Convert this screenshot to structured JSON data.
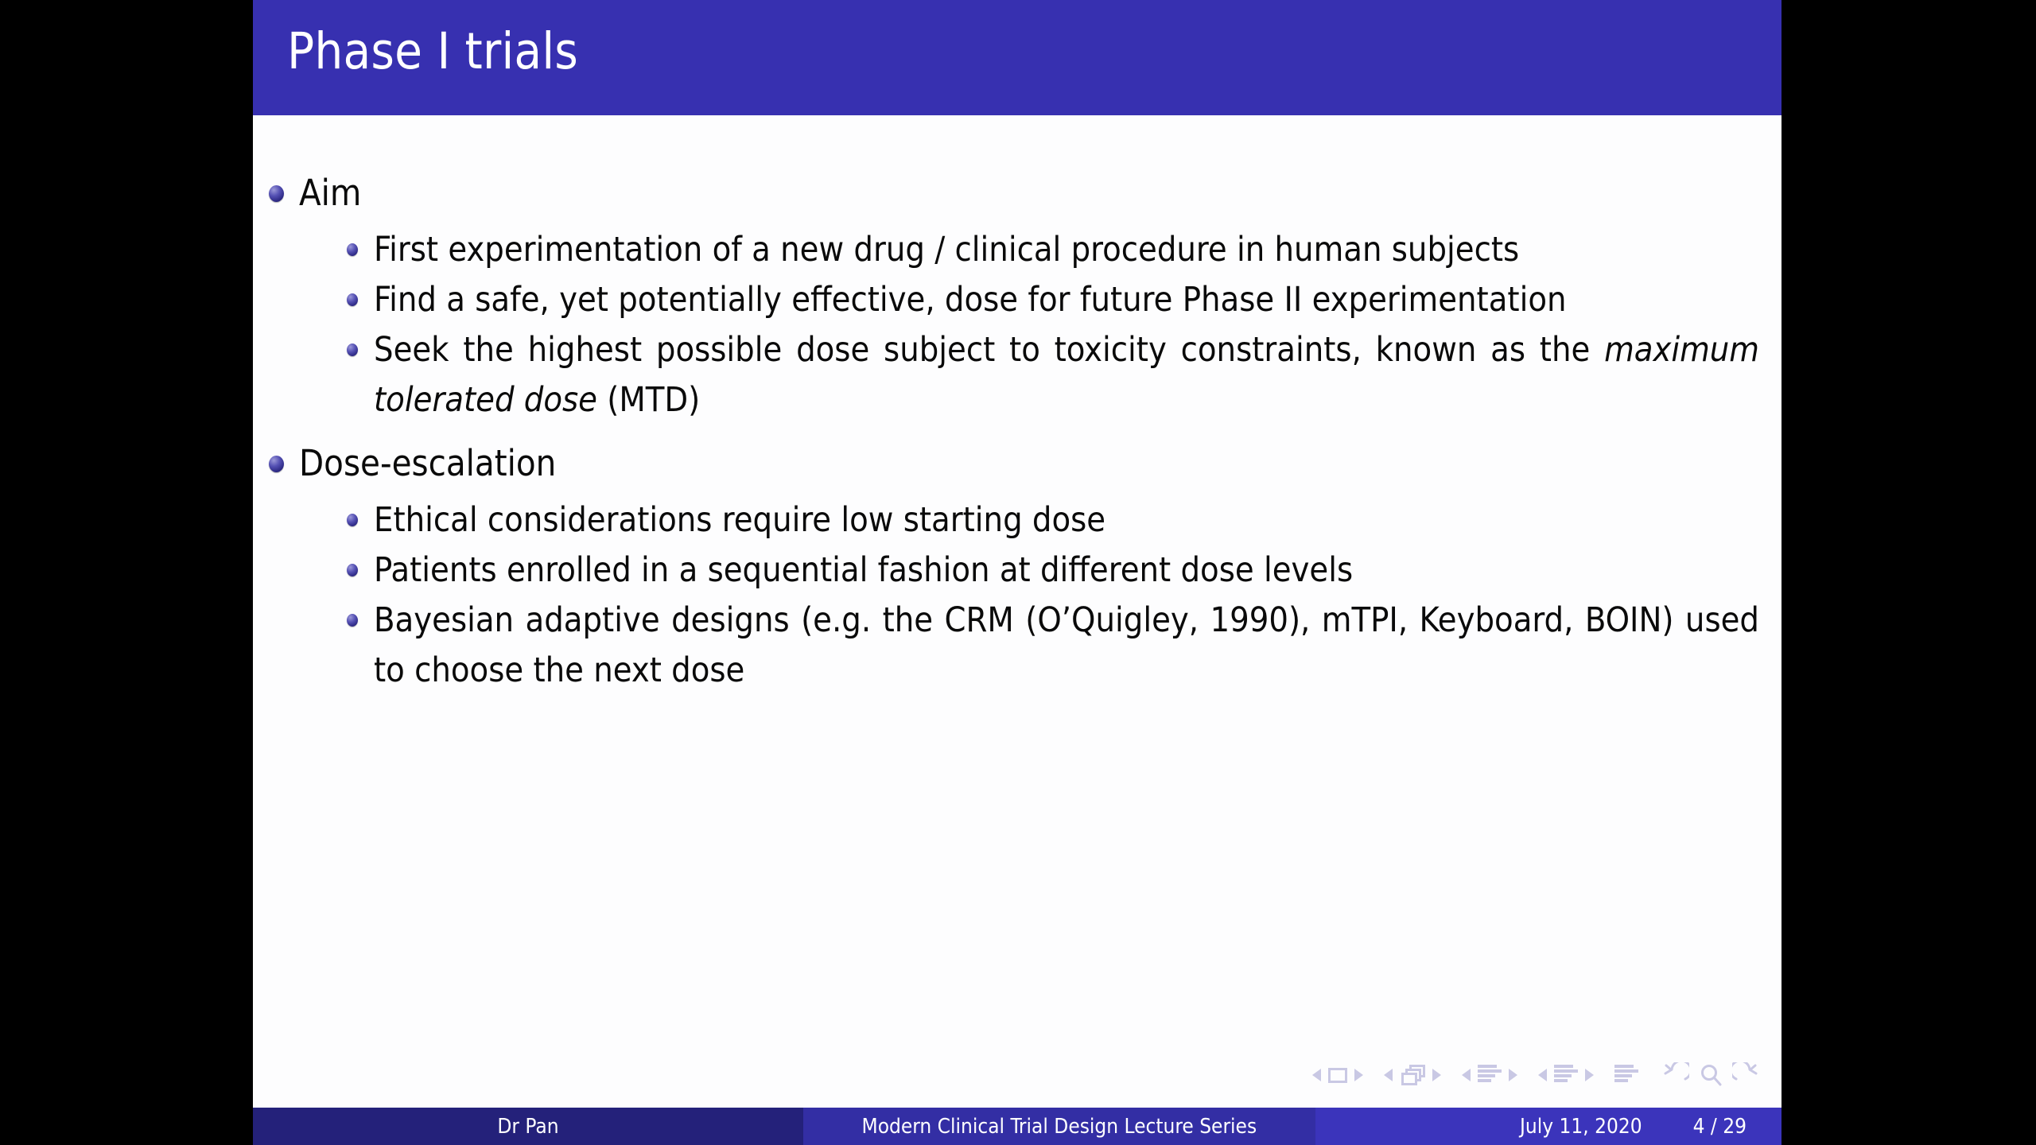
{
  "slide": {
    "title": "Phase I trials",
    "title_bar_color": "#3730b0",
    "background_color": "#fdfdfe",
    "outer_background_color": "#000000",
    "text_color": "#0a0a0a"
  },
  "content": {
    "items": [
      {
        "label": "Aim",
        "subitems": [
          {
            "text_before": "First experimentation of a new drug / clinical procedure in human subjects",
            "italic": "",
            "text_after": ""
          },
          {
            "text_before": "Find a safe, yet potentially effective, dose for future Phase II experimentation",
            "italic": "",
            "text_after": ""
          },
          {
            "text_before": "Seek the highest possible dose subject to toxicity constraints, known as the ",
            "italic": "maximum tolerated dose",
            "text_after": " (MTD)"
          }
        ]
      },
      {
        "label": "Dose-escalation",
        "subitems": [
          {
            "text_before": "Ethical considerations require low starting dose",
            "italic": "",
            "text_after": ""
          },
          {
            "text_before": "Patients enrolled in a sequential fashion at different dose levels",
            "italic": "",
            "text_after": ""
          },
          {
            "text_before": "Bayesian adaptive designs (e.g. the CRM (O’Quigley, 1990), mTPI, Keyboard, BOIN) used to choose the next dose",
            "italic": "",
            "text_after": ""
          }
        ]
      }
    ]
  },
  "navigation": {
    "icons": [
      "prev-frame-arrow-icon",
      "frame-square-icon",
      "next-frame-arrow-icon",
      "prev-slide-arrow-icon",
      "slide-stack-icon",
      "next-slide-arrow-icon",
      "prev-subsection-arrow-icon",
      "subsection-lines-icon",
      "next-subsection-arrow-icon",
      "prev-section-arrow-icon",
      "section-lines-icon",
      "next-section-arrow-icon",
      "document-lines-icon",
      "back-arrow-icon",
      "search-icon",
      "forward-arrow-icon"
    ],
    "color": "#c9c8e4"
  },
  "footer": {
    "author": "Dr Pan",
    "institute": "Modern Clinical Trial Design Lecture Series",
    "date": "July 11, 2020",
    "page": "4 / 29",
    "color_left": "#24217a",
    "color_mid": "#332ea4",
    "color_right": "#3b34bb"
  }
}
